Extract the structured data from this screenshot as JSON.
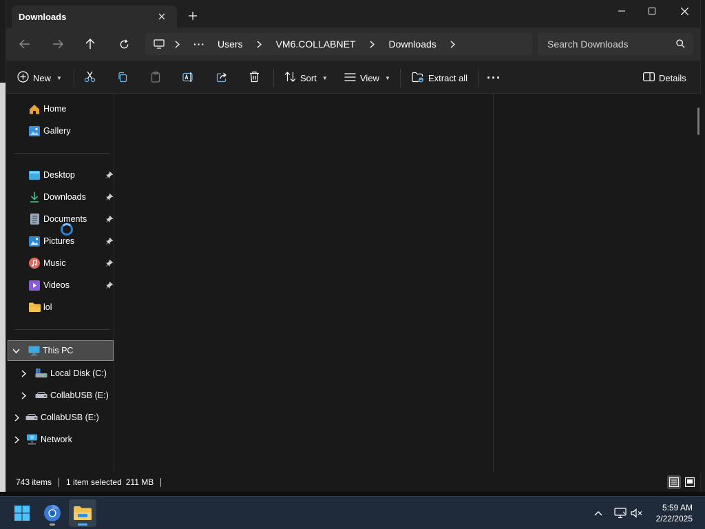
{
  "window": {
    "tab_title": "Downloads",
    "colors": {
      "accent": "#60b0f4",
      "background": "#191919",
      "toolbar": "#2c2c2c"
    }
  },
  "navigation": {
    "back_icon": "arrow-left-icon",
    "forward_icon": "arrow-right-icon",
    "up_icon": "arrow-up-icon",
    "refresh_icon": "refresh-icon",
    "breadcrumb": [
      "Users",
      "VM6.COLLABNET",
      "Downloads"
    ],
    "search_placeholder": "Search Downloads"
  },
  "commands": {
    "new_label": "New",
    "sort_label": "Sort",
    "view_label": "View",
    "extract_label": "Extract all",
    "details_label": "Details"
  },
  "sidebar": {
    "top": [
      {
        "label": "Home",
        "icon": "home-icon"
      },
      {
        "label": "Gallery",
        "icon": "gallery-icon"
      }
    ],
    "quick_access": [
      {
        "label": "Desktop",
        "icon": "desktop-icon",
        "pinned": true
      },
      {
        "label": "Downloads",
        "icon": "download-icon",
        "pinned": true
      },
      {
        "label": "Documents",
        "icon": "document-icon",
        "pinned": true
      },
      {
        "label": "Pictures",
        "icon": "pictures-icon",
        "pinned": true
      },
      {
        "label": "Music",
        "icon": "music-icon",
        "pinned": true
      },
      {
        "label": "Videos",
        "icon": "videos-icon",
        "pinned": true
      },
      {
        "label": "lol",
        "icon": "folder-icon",
        "pinned": false
      }
    ],
    "tree": [
      {
        "label": "This PC",
        "icon": "this-pc-icon",
        "expanded": true,
        "selected": true
      },
      {
        "label": "Local Disk (C:)",
        "icon": "local-disk-icon"
      },
      {
        "label": "CollabUSB (E:)",
        "icon": "usb-drive-icon"
      },
      {
        "label": "CollabUSB (E:)",
        "icon": "usb-drive-icon"
      },
      {
        "label": "Network",
        "icon": "network-icon"
      }
    ]
  },
  "status": {
    "item_count": "743 items",
    "selection": "1 item selected",
    "selection_size": "211 MB"
  },
  "taskbar": {
    "time": "5:59 AM",
    "date": "2/22/2025",
    "apps": [
      "windows-start-icon",
      "chrome-icon",
      "file-explorer-icon"
    ]
  }
}
